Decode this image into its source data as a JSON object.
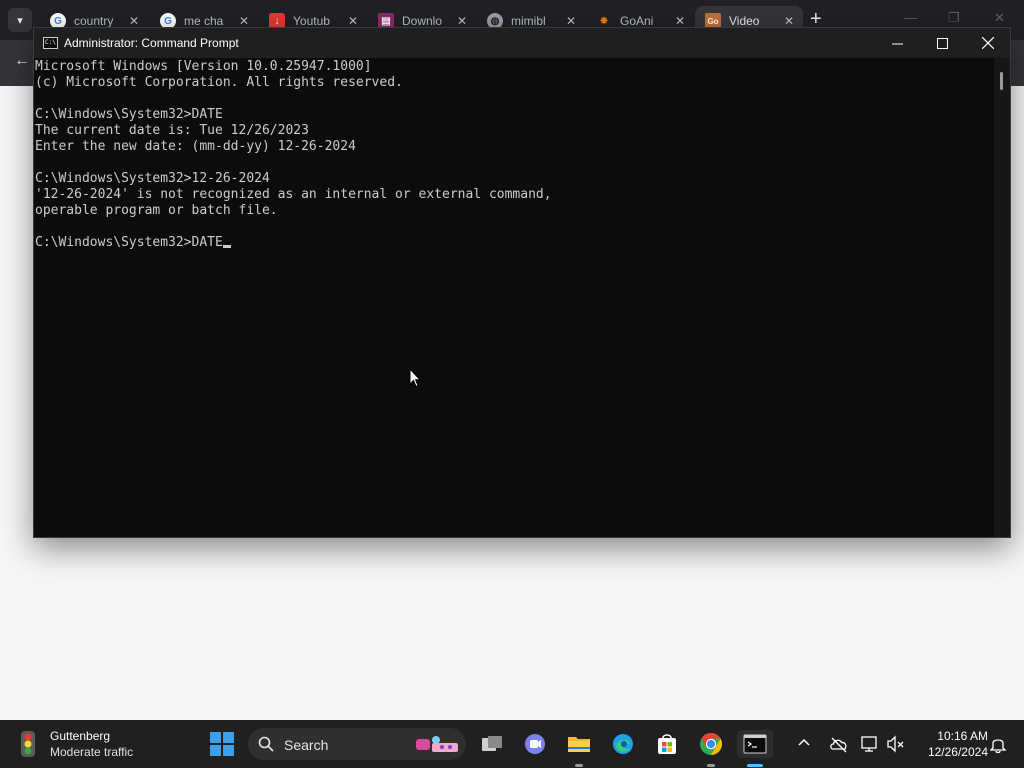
{
  "browser": {
    "tabs": [
      {
        "title": "country",
        "icon": "google-icon"
      },
      {
        "title": "me cha",
        "icon": "google-icon"
      },
      {
        "title": "Youtub",
        "icon": "download-icon"
      },
      {
        "title": "Downlo",
        "icon": "winrar-icon"
      },
      {
        "title": "mimibl",
        "icon": "globe-icon"
      },
      {
        "title": "GoAni",
        "icon": "goanimate-icon"
      },
      {
        "title": "Video",
        "icon": "video-icon"
      }
    ],
    "new_tab_label": "+"
  },
  "cmd": {
    "title": "Administrator: Command Prompt",
    "icon_text": "C:\\",
    "lines": [
      "Microsoft Windows [Version 10.0.25947.1000]",
      "(c) Microsoft Corporation. All rights reserved.",
      "",
      "C:\\Windows\\System32>DATE",
      "The current date is: Tue 12/26/2023",
      "Enter the new date: (mm-dd-yy) 12-26-2024",
      "",
      "C:\\Windows\\System32>12-26-2024",
      "'12-26-2024' is not recognized as an internal or external command,",
      "operable program or batch file.",
      "",
      "C:\\Windows\\System32>DATE"
    ]
  },
  "taskbar": {
    "weather_title": "Guttenberg",
    "weather_status": "Moderate traffic",
    "search_label": "Search",
    "time": "10:16 AM",
    "date": "12/26/2024"
  }
}
